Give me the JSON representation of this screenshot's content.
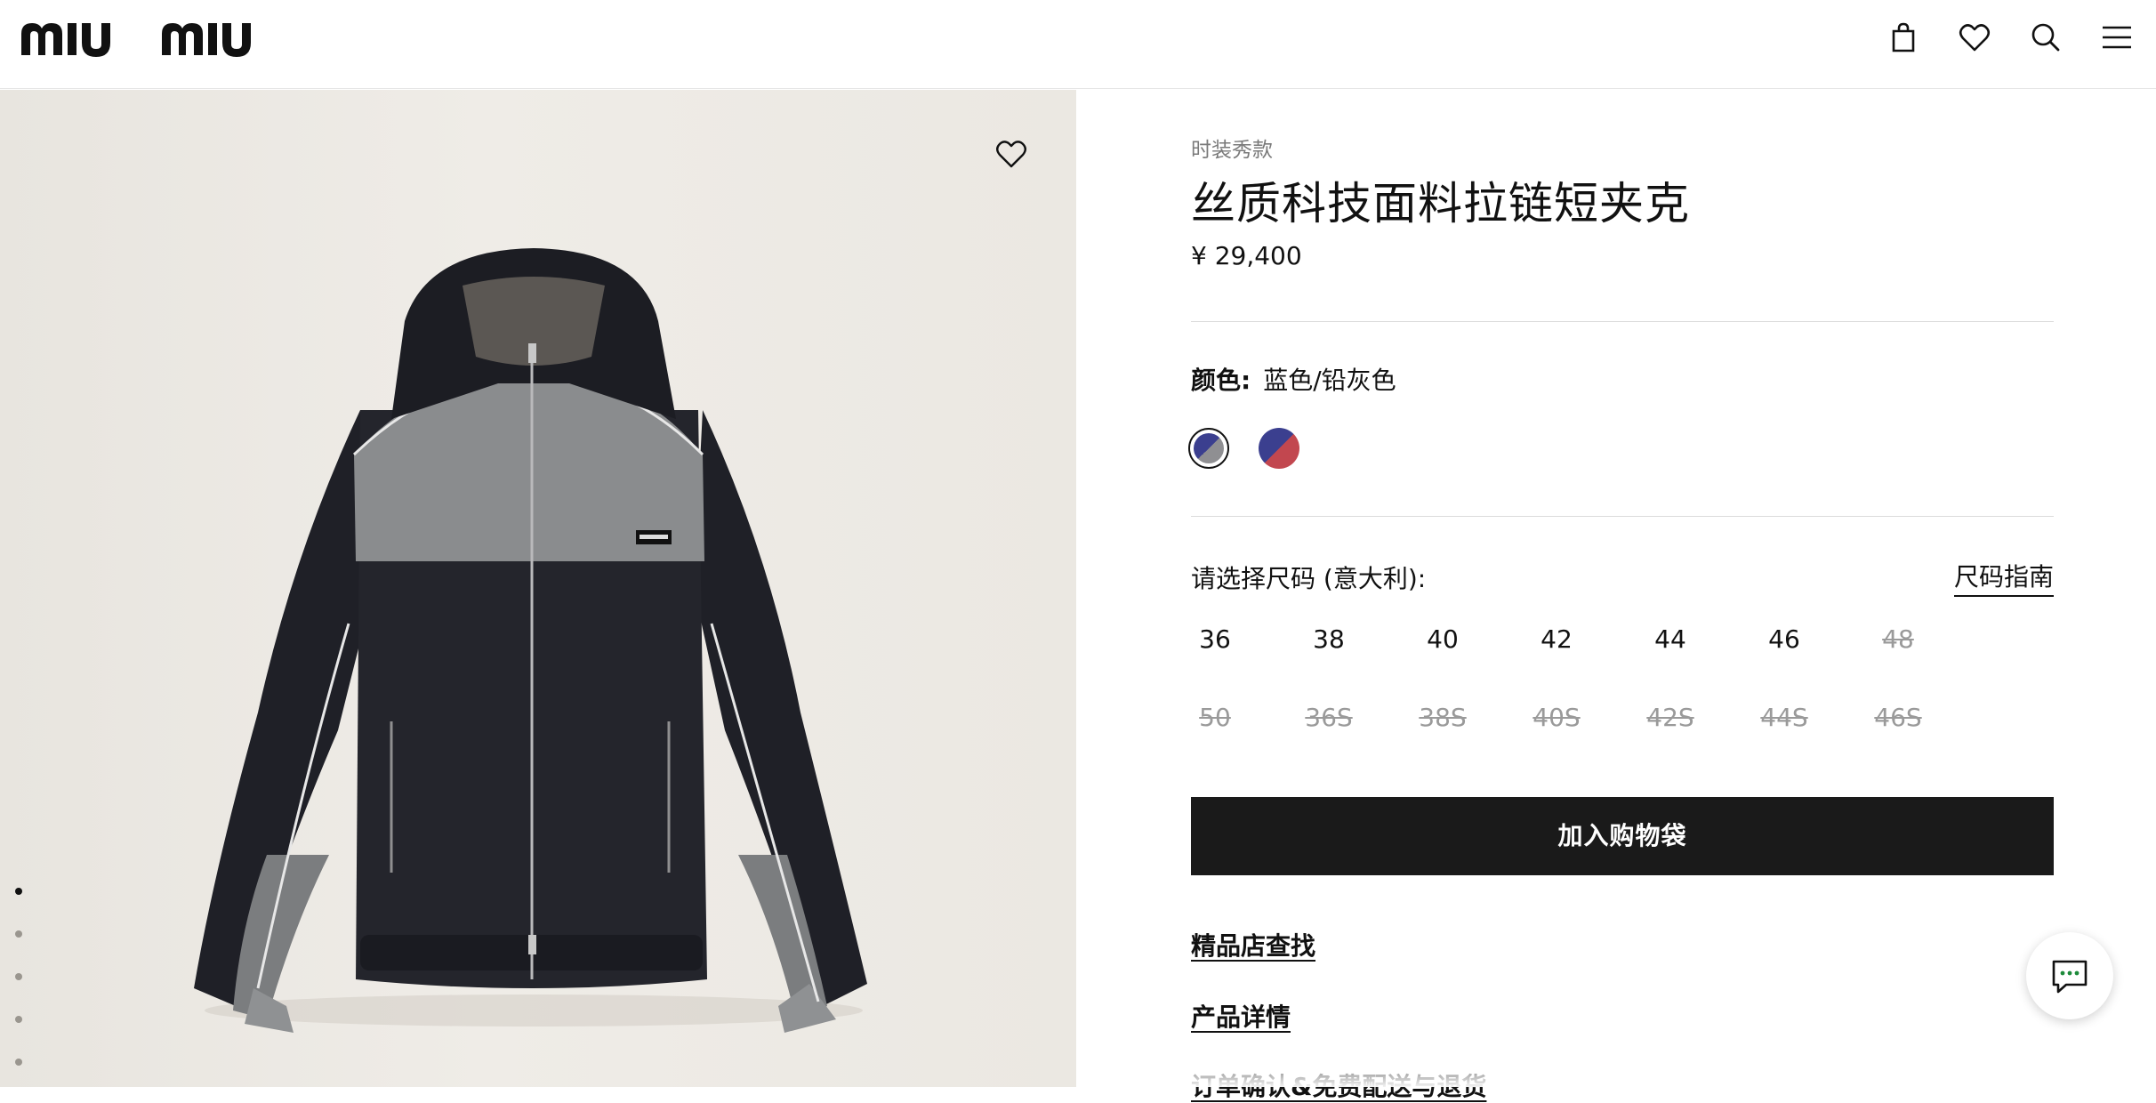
{
  "brand": {
    "logo_text": "miu miu"
  },
  "header": {
    "icons": [
      "shopping-bag-icon",
      "heart-icon",
      "search-icon",
      "menu-icon"
    ]
  },
  "gallery": {
    "wishlist_icon": "heart-outline-icon",
    "dot_count": 5,
    "active_dot": 0
  },
  "product": {
    "category": "时装秀款",
    "title": "丝质科技面料拉链短夹克",
    "price": "¥ 29,400",
    "color_label": "颜色:",
    "color_value": "蓝色/铅灰色",
    "swatches": [
      {
        "name": "蓝色/铅灰色",
        "colors": [
          "#3b3f8f",
          "#8f8f92"
        ],
        "selected": true
      },
      {
        "name": "蓝色/红色",
        "colors": [
          "#3b3f8f",
          "#c2474f"
        ],
        "selected": false
      }
    ],
    "size_label": "请选择尺码 (意大利):",
    "size_guide": "尺码指南",
    "sizes_row1": [
      {
        "label": "36",
        "available": true
      },
      {
        "label": "38",
        "available": true
      },
      {
        "label": "40",
        "available": true
      },
      {
        "label": "42",
        "available": true
      },
      {
        "label": "44",
        "available": true
      },
      {
        "label": "46",
        "available": true
      },
      {
        "label": "48",
        "available": false
      }
    ],
    "sizes_row2": [
      {
        "label": "50",
        "available": false
      },
      {
        "label": "36S",
        "available": false
      },
      {
        "label": "38S",
        "available": false
      },
      {
        "label": "40S",
        "available": false
      },
      {
        "label": "42S",
        "available": false
      },
      {
        "label": "44S",
        "available": false
      },
      {
        "label": "46S",
        "available": false
      }
    ],
    "add_to_bag": "加入购物袋",
    "links": [
      "精品店查找",
      "产品详情",
      "订单确认&免费配送与退货"
    ]
  },
  "chat": {
    "icon": "chat-bubble-icon"
  },
  "colors": {
    "button_bg": "#1a1a1a",
    "button_text": "#ffffff",
    "muted": "#9a9a9a"
  }
}
